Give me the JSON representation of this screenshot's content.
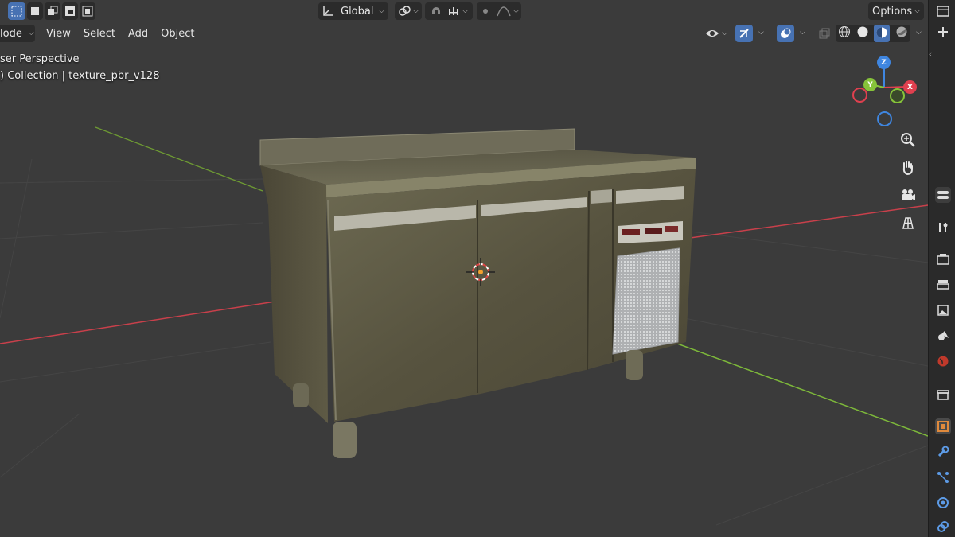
{
  "toolbar": {
    "transform_orientation": "Global",
    "options_label": "Options"
  },
  "header": {
    "mode_label": "lode",
    "menu": [
      "View",
      "Select",
      "Add",
      "Object"
    ]
  },
  "viewport": {
    "perspective_label": "ser Perspective",
    "collection_label": ") Collection | texture_pbr_v128"
  },
  "gizmo": {
    "x_label": "X",
    "y_label": "Y",
    "z_label": "Z"
  },
  "colors": {
    "x_axis": "#e0404f",
    "y_axis": "#86c33a",
    "z_axis": "#3f86e0",
    "accent": "#4772b3",
    "selected_tab": "#e08a3c"
  },
  "right_tabs": [
    "tool-tab",
    "render-tab",
    "output-tab",
    "view-layer-tab",
    "scene-tab",
    "world-tab",
    "collection-tab",
    "object-tab",
    "modifier-tab",
    "particles-tab",
    "physics-tab",
    "constraints-tab"
  ]
}
